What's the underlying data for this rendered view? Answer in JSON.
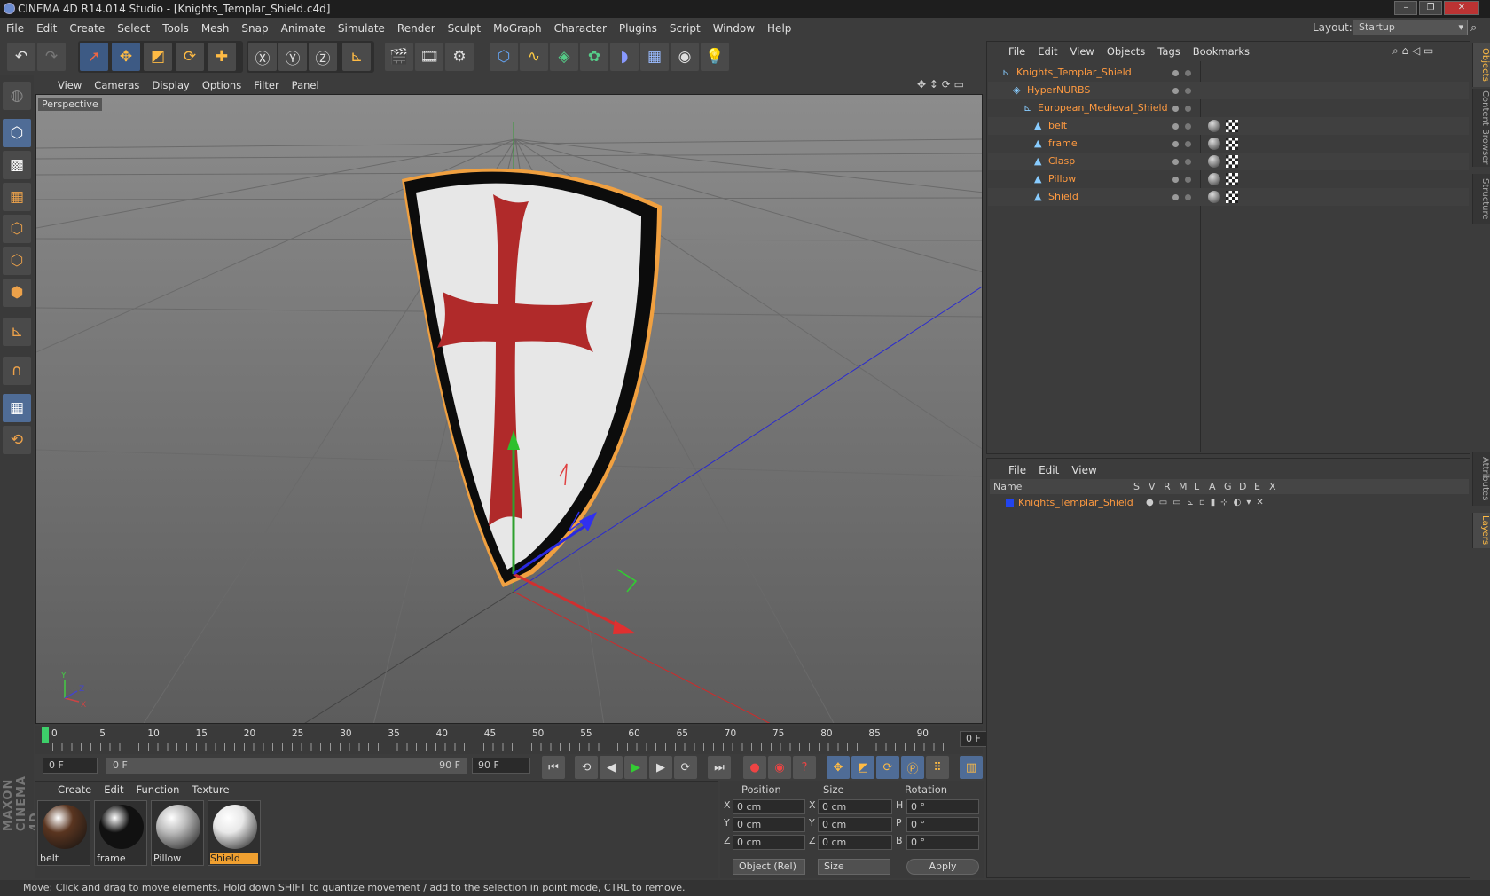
{
  "window": {
    "title": "CINEMA 4D R14.014 Studio - [Knights_Templar_Shield.c4d]"
  },
  "menubar": {
    "items": [
      "File",
      "Edit",
      "Create",
      "Select",
      "Tools",
      "Mesh",
      "Snap",
      "Animate",
      "Simulate",
      "Render",
      "Sculpt",
      "MoGraph",
      "Character",
      "Plugins",
      "Script",
      "Window",
      "Help"
    ]
  },
  "layout": {
    "label": "Layout:",
    "value": "Startup"
  },
  "viewport": {
    "menu": [
      "View",
      "Cameras",
      "Display",
      "Options",
      "Filter",
      "Panel"
    ],
    "label": "Perspective",
    "axis_labels": {
      "y": "Y",
      "z": "Z",
      "x": "X"
    }
  },
  "timeline": {
    "ticks": [
      "0",
      "5",
      "10",
      "15",
      "20",
      "25",
      "30",
      "35",
      "40",
      "45",
      "50",
      "55",
      "60",
      "65",
      "70",
      "75",
      "80",
      "85",
      "90"
    ],
    "current_frame": "0 F",
    "start_field": "0 F",
    "range_start": "0 F",
    "range_end": "90 F",
    "end_field": "90 F"
  },
  "materials": {
    "menu": [
      "Create",
      "Edit",
      "Function",
      "Texture"
    ],
    "items": [
      {
        "name": "belt",
        "color": "#5a3520",
        "selected": false
      },
      {
        "name": "frame",
        "color": "#111111",
        "selected": false
      },
      {
        "name": "Pillow",
        "color": "#bbbbbb",
        "selected": false
      },
      {
        "name": "Shield",
        "color": "#e8e8e8",
        "selected": true
      }
    ]
  },
  "coordinates": {
    "headers": {
      "position": "Position",
      "size": "Size",
      "rotation": "Rotation"
    },
    "rows": [
      {
        "axis": "X",
        "pos": "0 cm",
        "size_axis": "X",
        "size": "0 cm",
        "rot_axis": "H",
        "rot": "0 °"
      },
      {
        "axis": "Y",
        "pos": "0 cm",
        "size_axis": "Y",
        "size": "0 cm",
        "rot_axis": "P",
        "rot": "0 °"
      },
      {
        "axis": "Z",
        "pos": "0 cm",
        "size_axis": "Z",
        "size": "0 cm",
        "rot_axis": "B",
        "rot": "0 °"
      }
    ],
    "mode": "Object (Rel)",
    "size_mode": "Size",
    "apply": "Apply"
  },
  "objects": {
    "menu": [
      "File",
      "Edit",
      "View",
      "Objects",
      "Tags",
      "Bookmarks"
    ],
    "items": [
      {
        "name": "Knights_Templar_Shield",
        "depth": 0
      },
      {
        "name": "HyperNURBS",
        "depth": 1
      },
      {
        "name": "European_Medieval_Shield",
        "depth": 2
      },
      {
        "name": "belt",
        "depth": 3
      },
      {
        "name": "frame",
        "depth": 3
      },
      {
        "name": "Clasp",
        "depth": 3
      },
      {
        "name": "Pillow",
        "depth": 3
      },
      {
        "name": "Shield",
        "depth": 3
      }
    ]
  },
  "layers": {
    "menu": [
      "File",
      "Edit",
      "View"
    ],
    "columns": [
      "Name",
      "S",
      "V",
      "R",
      "M",
      "L",
      "A",
      "G",
      "D",
      "E",
      "X"
    ],
    "rows": [
      {
        "name": "Knights_Templar_Shield",
        "color": "#2244ee"
      }
    ]
  },
  "side_tabs": [
    "Objects",
    "Content Browser",
    "Structure",
    "Attributes",
    "Layers"
  ],
  "status": "Move: Click and drag to move elements. Hold down SHIFT to quantize movement / add to the selection in point mode, CTRL to remove.",
  "brand": "MAXON CINEMA 4D"
}
